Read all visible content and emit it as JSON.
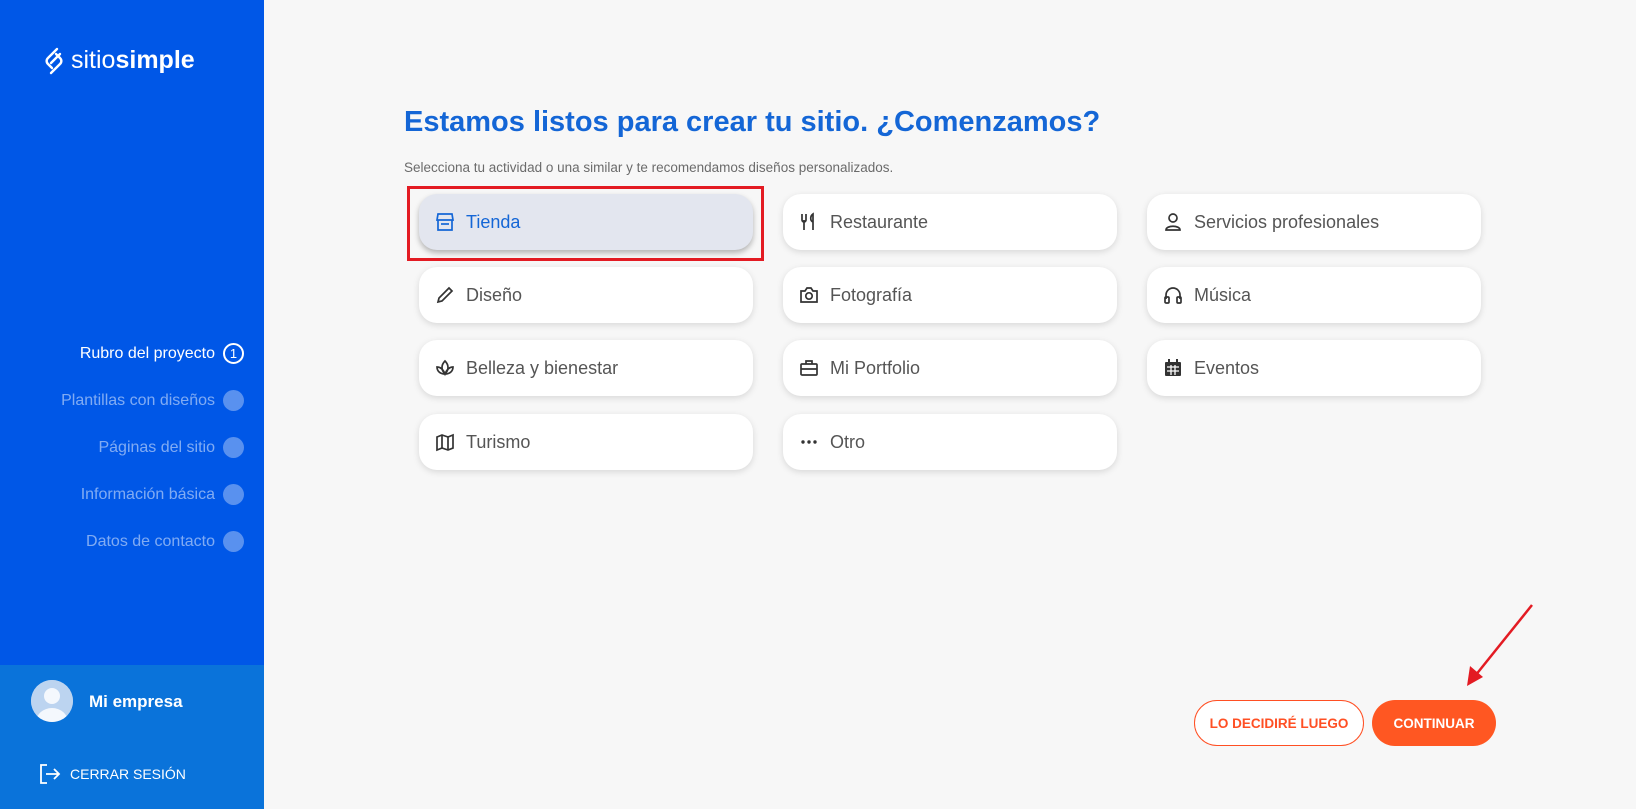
{
  "brand": {
    "name_light": "sitio",
    "name_bold": "simple"
  },
  "steps": [
    {
      "label": "Rubro del proyecto",
      "number": "1",
      "active": true
    },
    {
      "label": "Plantillas con diseños",
      "number": "",
      "active": false
    },
    {
      "label": "Páginas del sitio",
      "number": "",
      "active": false
    },
    {
      "label": "Información básica",
      "number": "",
      "active": false
    },
    {
      "label": "Datos de contacto",
      "number": "",
      "active": false
    }
  ],
  "user": {
    "name": "Mi empresa",
    "logout_label": "CERRAR SESIÓN"
  },
  "main": {
    "title": "Estamos listos para crear tu sitio. ¿Comenzamos?",
    "subtitle": "Selecciona tu actividad o una similar y te recomendamos diseños personalizados."
  },
  "categories": [
    {
      "label": "Tienda",
      "icon": "store-icon",
      "selected": true
    },
    {
      "label": "Restaurante",
      "icon": "fork-knife-icon",
      "selected": false
    },
    {
      "label": "Servicios profesionales",
      "icon": "professional-icon",
      "selected": false
    },
    {
      "label": "Diseño",
      "icon": "pencil-icon",
      "selected": false
    },
    {
      "label": "Fotografía",
      "icon": "camera-icon",
      "selected": false
    },
    {
      "label": "Música",
      "icon": "headphones-icon",
      "selected": false
    },
    {
      "label": "Belleza y bienestar",
      "icon": "lotus-icon",
      "selected": false
    },
    {
      "label": "Mi Portfolio",
      "icon": "briefcase-icon",
      "selected": false
    },
    {
      "label": "Eventos",
      "icon": "calendar-icon",
      "selected": false
    },
    {
      "label": "Turismo",
      "icon": "map-icon",
      "selected": false
    },
    {
      "label": "Otro",
      "icon": "ellipsis-icon",
      "selected": false
    }
  ],
  "actions": {
    "later_label": "LO DECIDIRÉ LUEGO",
    "continue_label": "CONTINUAR"
  },
  "colors": {
    "sidebar": "#0057e7",
    "accent": "#ff5722",
    "title": "#1466d6",
    "annotation": "#e31b23"
  }
}
